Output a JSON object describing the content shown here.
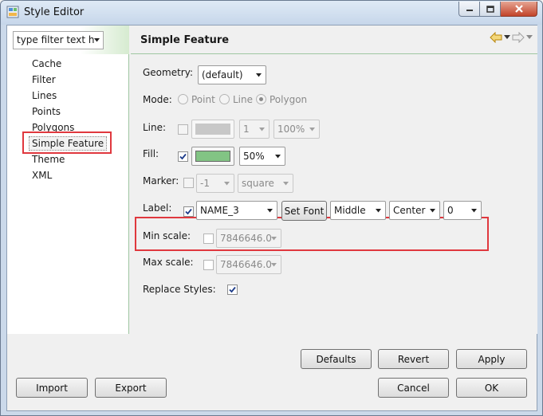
{
  "window": {
    "title": "Style Editor"
  },
  "left": {
    "filter_placeholder": "type filter text h",
    "items": [
      "Cache",
      "Filter",
      "Lines",
      "Points",
      "Polygons",
      "Simple Feature",
      "Theme",
      "XML"
    ],
    "selected": "Simple Feature"
  },
  "panel": {
    "title": "Simple Feature",
    "geometry": {
      "label": "Geometry:",
      "value": "(default)"
    },
    "mode": {
      "label": "Mode:",
      "options": [
        "Point",
        "Line",
        "Polygon"
      ],
      "selected": "Polygon"
    },
    "line": {
      "label": "Line:",
      "width": "1",
      "opacity": "100%",
      "color": "#c8c8c8"
    },
    "fill": {
      "label": "Fill:",
      "opacity": "50%",
      "color": "#82c484"
    },
    "marker": {
      "label": "Marker:",
      "size": "-1",
      "shape": "square"
    },
    "label": {
      "label": "Label:",
      "field": "NAME_3",
      "set_font": "Set Font",
      "vertical": "Middle",
      "horizontal": "Center",
      "rotation": "0"
    },
    "min_scale": {
      "label": "Min scale:",
      "value": "7846646.0"
    },
    "max_scale": {
      "label": "Max scale:",
      "value": "7846646.0"
    },
    "replace": {
      "label": "Replace Styles:"
    }
  },
  "buttons": {
    "defaults": "Defaults",
    "revert": "Revert",
    "apply": "Apply",
    "import": "Import",
    "export": "Export",
    "cancel": "Cancel",
    "ok": "OK"
  }
}
